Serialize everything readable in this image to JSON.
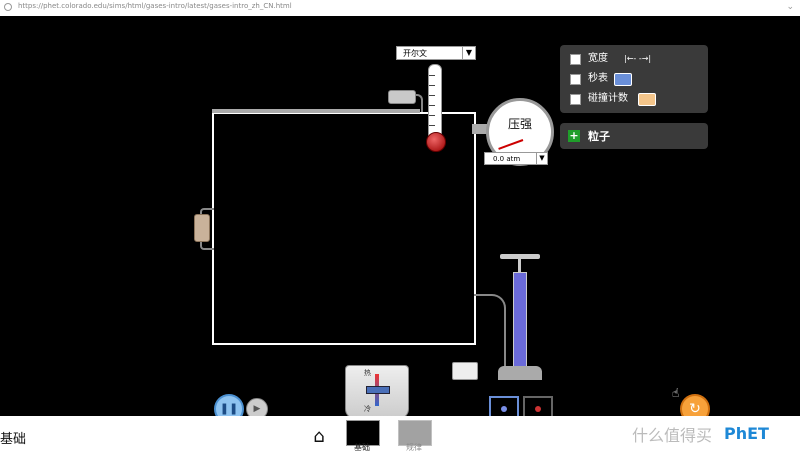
{
  "browser": {
    "url": "https://phet.colorado.edu/sims/html/gases-intro/latest/gases-intro_zh_CN.html",
    "menu_icon": "chevron-down-icon"
  },
  "controls": {
    "temperature_unit": "开尔文",
    "pressure_label": "压强",
    "pressure_value": "0.0 atm",
    "width_label": "宽度",
    "stopwatch_label": "秒表",
    "collision_label": "碰撞计数",
    "particles_label": "粒子",
    "hot_label": "热",
    "cold_label": "冷"
  },
  "sim": {
    "accent": "#6a8fd8",
    "reset_color": "#f7a13a"
  },
  "nav": {
    "screen_title": "基础",
    "tabs": [
      {
        "label": "基础"
      },
      {
        "label": "规律"
      }
    ]
  },
  "watermark": {
    "site": "什么值得买",
    "brand": "PhET"
  }
}
